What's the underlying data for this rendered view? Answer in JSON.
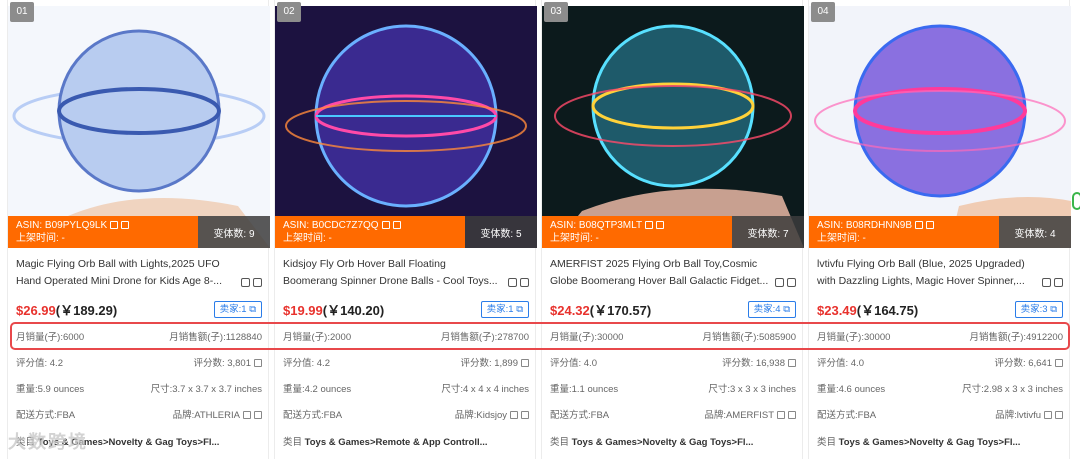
{
  "cards": [
    {
      "rank": "01",
      "asin": "ASIN: B09PYLQ9LK",
      "listing": "上架时间: -",
      "variants": "变体数: 9",
      "title1": "Magic Flying Orb Ball with Lights,2025 UFO",
      "title2": "Hand Operated Mini Drone for Kids Age 8-...",
      "price_usd": "$26.99",
      "price_cny": "(￥189.29)",
      "seller": "卖家:1",
      "monthly_sales": "月销量(子):6000",
      "monthly_revenue": "月销售额(子):1128840",
      "rating": "评分值: 4.2",
      "reviews": "评分数: 3,801",
      "weight": "重量:5.9 ounces",
      "size": "尺寸:3.7 x 3.7 x 3.7 inches",
      "fulfillment": "配送方式:FBA",
      "brand": "品牌:ATHLERIA",
      "category_label": "类目",
      "category": "Toys & Games>Novelty & Gag Toys>Fl...",
      "image_colors": [
        "#9db8e8",
        "#dfe8f8"
      ]
    },
    {
      "rank": "02",
      "asin": "ASIN: B0CDC7Z7QQ",
      "listing": "上架时间: -",
      "variants": "变体数: 5",
      "title1": "Kidsjoy Fly Orb Hover Ball Floating",
      "title2": "Boomerang Spinner Drone Balls - Cool Toys...",
      "price_usd": "$19.99",
      "price_cny": "(￥140.20)",
      "seller": "卖家:1",
      "monthly_sales": "月销量(子):2000",
      "monthly_revenue": "月销售额(子):278700",
      "rating": "评分值: 4.2",
      "reviews": "评分数: 1,899",
      "weight": "重量:4.2 ounces",
      "size": "尺寸:4 x 4 x 4 inches",
      "fulfillment": "配送方式:FBA",
      "brand": "品牌:Kidsjoy",
      "category_label": "类目",
      "category": "Toys & Games>Remote & App Controll...",
      "image_colors": [
        "#1a1040",
        "#4a3ab8"
      ]
    },
    {
      "rank": "03",
      "asin": "ASIN: B08QTP3MLT",
      "listing": "上架时间: -",
      "variants": "变体数: 7",
      "title1": "AMERFIST 2025 Flying Orb Ball Toy,Cosmic",
      "title2": "Globe Boomerang Hover Ball Galactic Fidget...",
      "price_usd": "$24.32",
      "price_cny": "(￥170.57)",
      "seller": "卖家:4",
      "monthly_sales": "月销量(子):30000",
      "monthly_revenue": "月销售额(子):5085900",
      "rating": "评分值: 4.0",
      "reviews": "评分数: 16,938",
      "weight": "重量:1.1 ounces",
      "size": "尺寸:3 x 3 x 3 inches",
      "fulfillment": "配送方式:FBA",
      "brand": "品牌:AMERFIST",
      "category_label": "类目",
      "category": "Toys & Games>Novelty & Gag Toys>Fl...",
      "image_colors": [
        "#0a1a20",
        "#2a8a8a"
      ]
    },
    {
      "rank": "04",
      "asin": "ASIN: B08RDHNN9B",
      "listing": "上架时间: -",
      "variants": "变体数: 4",
      "title1": "lvtivfu Flying Orb Ball (Blue, 2025 Upgraded)",
      "title2": "with Dazzling Lights, Magic Hover Spinner,...",
      "price_usd": "$23.49",
      "price_cny": "(￥164.75)",
      "seller": "卖家:3",
      "monthly_sales": "月销量(子):30000",
      "monthly_revenue": "月销售额(子):4912200",
      "rating": "评分值: 4.0",
      "reviews": "评分数: 6,641",
      "weight": "重量:4.6 ounces",
      "size": "尺寸:2.98 x 3 x 3 inches",
      "fulfillment": "配送方式:FBA",
      "brand": "品牌:lvtivfu",
      "category_label": "类目",
      "category": "Toys & Games>Novelty & Gag Toys>Fl...",
      "image_colors": [
        "#e0e8f8",
        "#ff5ab0"
      ]
    }
  ],
  "watermark": "大数跨境"
}
